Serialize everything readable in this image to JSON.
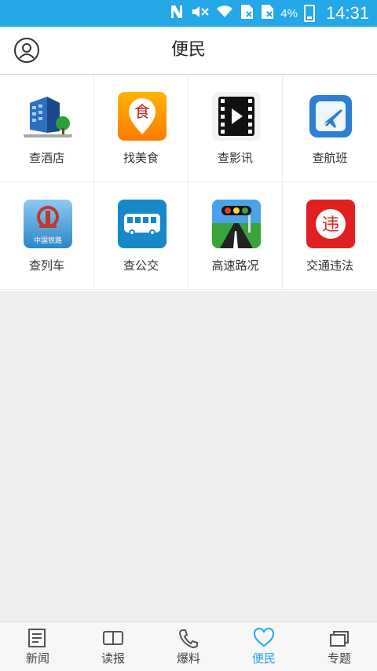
{
  "status": {
    "time": "14:31",
    "battery": "4%"
  },
  "header": {
    "title": "便民"
  },
  "services": [
    {
      "label": "查酒店",
      "icon": "hotel-icon"
    },
    {
      "label": "找美食",
      "icon": "food-icon"
    },
    {
      "label": "查影讯",
      "icon": "movie-icon"
    },
    {
      "label": "查航班",
      "icon": "flight-icon"
    },
    {
      "label": "查列车",
      "icon": "train-icon"
    },
    {
      "label": "查公交",
      "icon": "bus-icon"
    },
    {
      "label": "高速路况",
      "icon": "traffic-light-icon"
    },
    {
      "label": "交通违法",
      "icon": "violation-icon"
    }
  ],
  "food_icon_char": "食",
  "violation_icon_char": "违",
  "railway_text": "中国铁路",
  "tabs": [
    {
      "label": "新闻",
      "icon": "news-icon"
    },
    {
      "label": "读报",
      "icon": "newspaper-icon"
    },
    {
      "label": "爆料",
      "icon": "phone-icon"
    },
    {
      "label": "便民",
      "icon": "heart-icon",
      "active": true
    },
    {
      "label": "专题",
      "icon": "stack-icon"
    }
  ],
  "colors": {
    "accent": "#24a8e8"
  }
}
